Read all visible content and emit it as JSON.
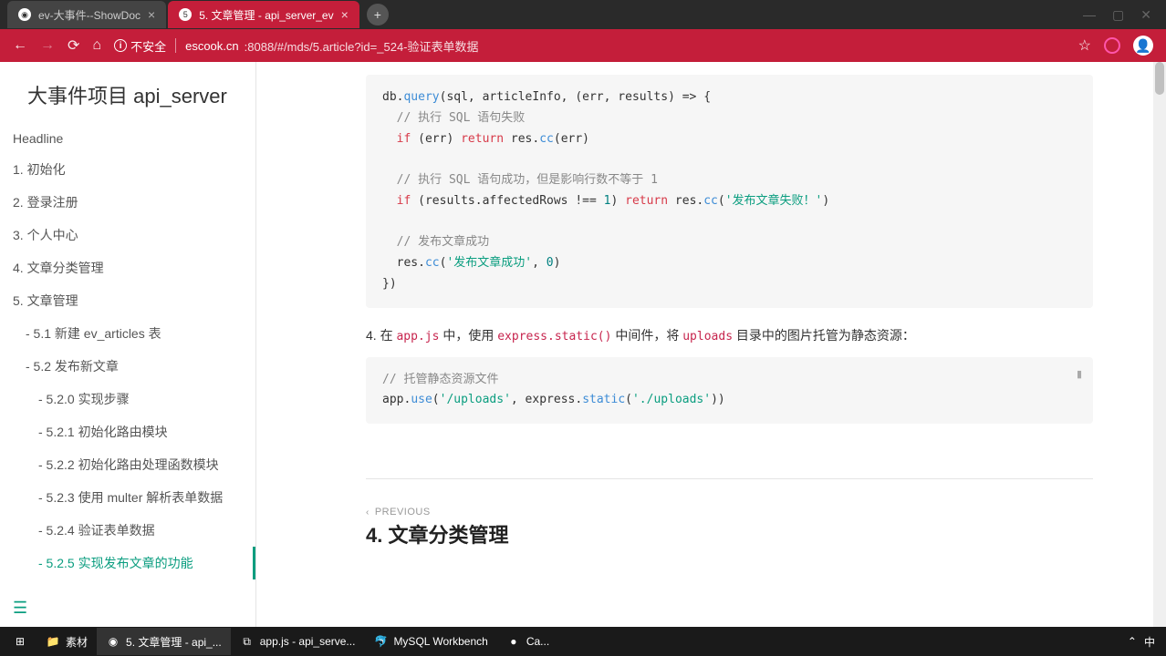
{
  "window": {
    "min": "—",
    "max": "▢",
    "close": "✕"
  },
  "tabs": [
    {
      "title": "ev-大事件--ShowDoc",
      "active": false
    },
    {
      "title": "5. 文章管理 - api_server_ev",
      "active": true
    }
  ],
  "address": {
    "security": "不安全",
    "url_host": "escook.cn",
    "url_rest": ":8088/#/mds/5.article?id=_524-验证表单数据"
  },
  "sidebar": {
    "title": "大事件项目 api_server",
    "items": [
      {
        "label": "Headline",
        "level": 1
      },
      {
        "label": "1. 初始化",
        "level": 1
      },
      {
        "label": "2. 登录注册",
        "level": 1
      },
      {
        "label": "3. 个人中心",
        "level": 1
      },
      {
        "label": "4. 文章分类管理",
        "level": 1
      },
      {
        "label": "5. 文章管理",
        "level": 1
      },
      {
        "label": "- 5.1 新建 ev_articles 表",
        "level": 2
      },
      {
        "label": "- 5.2 发布新文章",
        "level": 2
      },
      {
        "label": "- 5.2.0 实现步骤",
        "level": 3
      },
      {
        "label": "- 5.2.1 初始化路由模块",
        "level": 3
      },
      {
        "label": "- 5.2.2 初始化路由处理函数模块",
        "level": 3
      },
      {
        "label": "- 5.2.3 使用 multer 解析表单数据",
        "level": 3
      },
      {
        "label": "- 5.2.4 验证表单数据",
        "level": 3
      },
      {
        "label": "- 5.2.5 实现发布文章的功能",
        "level": 3,
        "active": true
      }
    ]
  },
  "content": {
    "code1": {
      "l1a": "db.",
      "l1b": "query",
      "l1c": "(sql, articleInfo, (err, results) => {",
      "l2": "// 执行 SQL 语句失败",
      "l3a": "if",
      "l3b": " (err) ",
      "l3c": "return",
      "l3d": " res.",
      "l3e": "cc",
      "l3f": "(err)",
      "l4": "// 执行 SQL 语句成功，但是影响行数不等于 1",
      "l5a": "if",
      "l5b": " (results.affectedRows !== ",
      "l5c": "1",
      "l5d": ") ",
      "l5e": "return",
      "l5f": " res.",
      "l5g": "cc",
      "l5h": "(",
      "l5i": "'发布文章失败！'",
      "l5j": ")",
      "l6": "// 发布文章成功",
      "l7a": "res.",
      "l7b": "cc",
      "l7c": "(",
      "l7d": "'发布文章成功'",
      "l7e": ", ",
      "l7f": "0",
      "l7g": ")",
      "l8": "})"
    },
    "para": {
      "p1": "4. 在 ",
      "p2": "app.js",
      "p3": " 中，使用 ",
      "p4": "express.static()",
      "p5": " 中间件，将 ",
      "p6": "uploads",
      "p7": " 目录中的图片托管为静态资源："
    },
    "code2": {
      "l1": "// 托管静态资源文件",
      "l2a": "app.",
      "l2b": "use",
      "l2c": "(",
      "l2d": "'/uploads'",
      "l2e": ", express.",
      "l2f": "static",
      "l2g": "(",
      "l2h": "'./uploads'",
      "l2i": "))"
    },
    "prev": {
      "label": "PREVIOUS",
      "title": "4. 文章分类管理"
    },
    "copy": "▮"
  },
  "taskbar": {
    "items": [
      {
        "icon": "⊞",
        "label": ""
      },
      {
        "icon": "📁",
        "label": "素材"
      },
      {
        "icon": "◉",
        "label": "5. 文章管理 - api_...",
        "active": true
      },
      {
        "icon": "⧉",
        "label": "app.js - api_serve..."
      },
      {
        "icon": "🐬",
        "label": "MySQL Workbench"
      },
      {
        "icon": "●",
        "label": "Ca..."
      }
    ],
    "right": {
      "up": "⌃",
      "ime": "中"
    }
  }
}
